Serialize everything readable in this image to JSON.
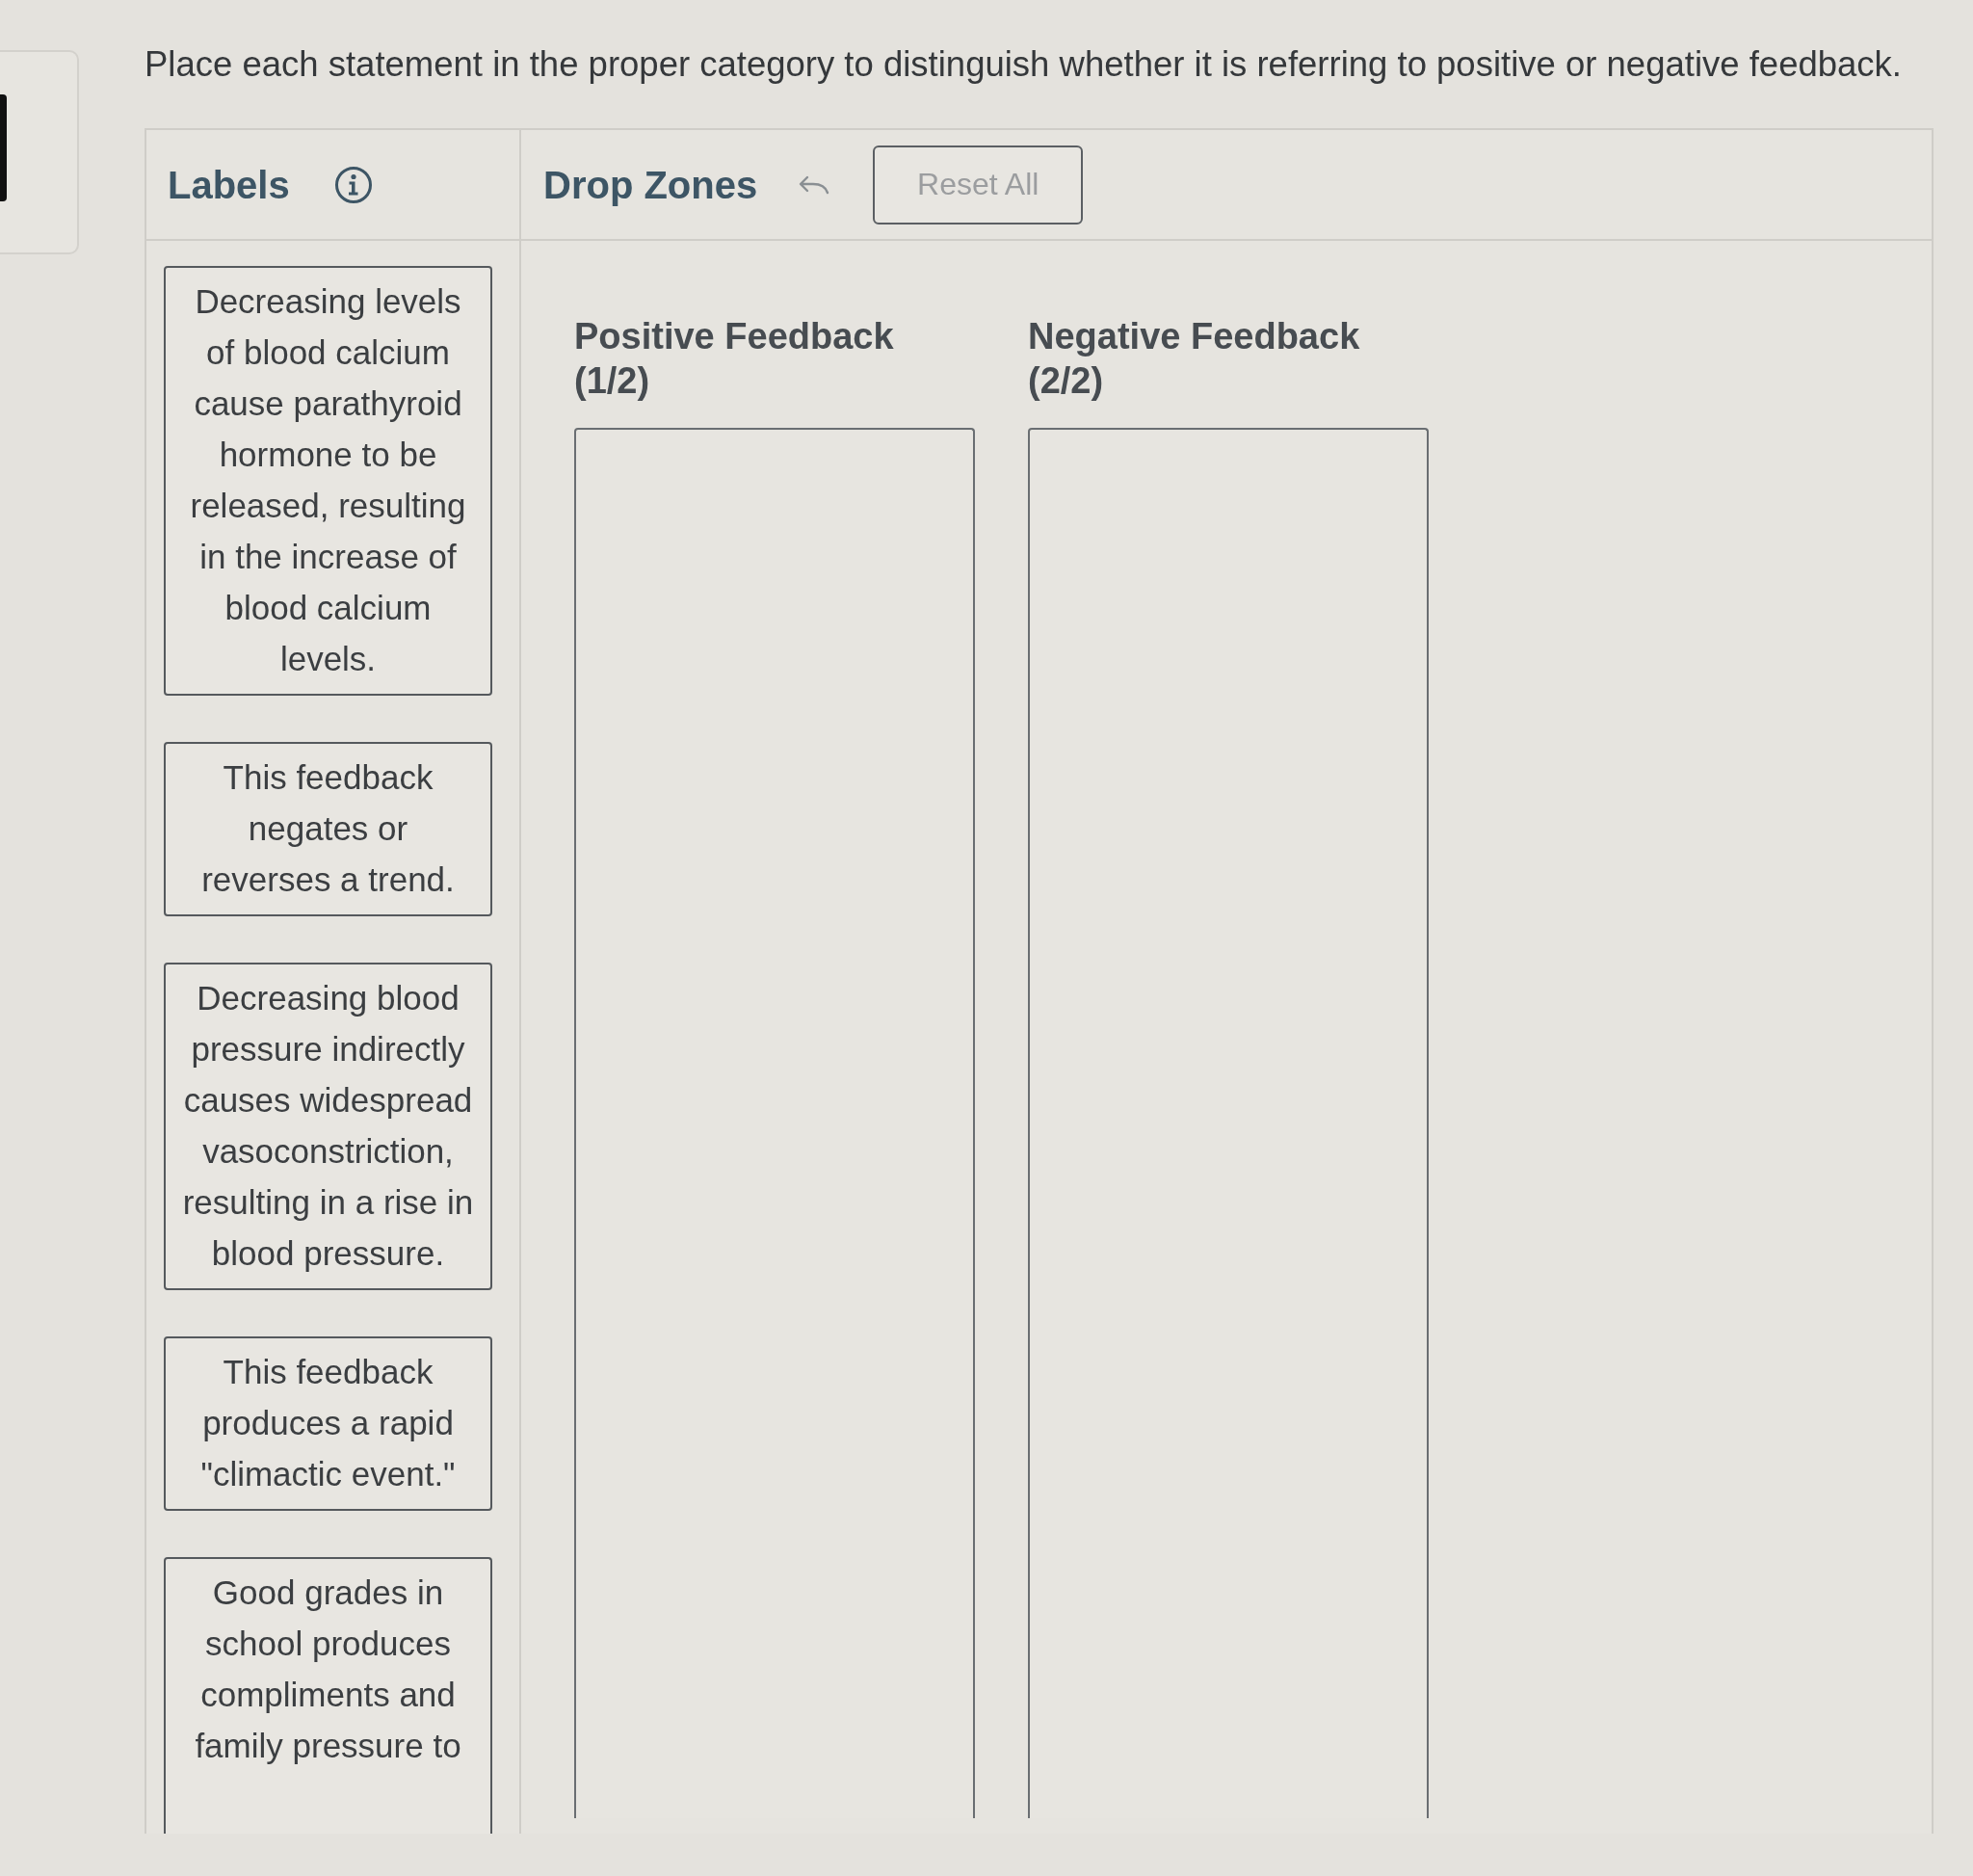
{
  "instructions": "Place each statement in the proper category to distinguish whether it is referring to positive or negative feedback.",
  "labels_panel": {
    "title": "Labels",
    "cards": [
      {
        "text": "Decreasing levels of blood calcium cause parathyroid hormone to be released, resulting in the increase of blood calcium levels."
      },
      {
        "text": "This feedback negates or reverses a trend."
      },
      {
        "text": "Decreasing blood pressure indirectly causes widespread vasoconstriction, resulting in a rise in blood pressure."
      },
      {
        "text": "This feedback produces a rapid \"climactic event.\""
      },
      {
        "text": "Good grades in school produces compliments and family pressure to"
      }
    ]
  },
  "drop_zones_panel": {
    "title": "Drop Zones",
    "reset_button": {
      "label": "Reset All",
      "disabled": true
    },
    "zones": [
      {
        "title": "Positive Feedback",
        "count": "(1/2)"
      },
      {
        "title": "Negative Feedback",
        "count": "(2/2)"
      }
    ]
  }
}
